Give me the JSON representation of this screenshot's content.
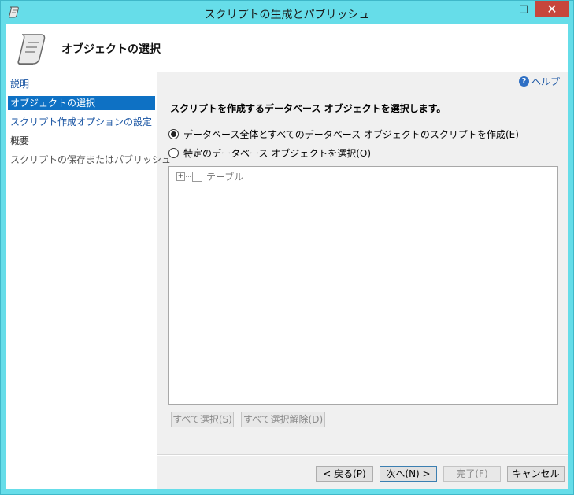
{
  "window": {
    "title": "スクリプトの生成とパブリッシュ",
    "min_glyph": "—",
    "max_glyph": "□",
    "close_glyph": "✕"
  },
  "header": {
    "title": "オブジェクトの選択"
  },
  "nav": {
    "items": [
      {
        "label": "説明"
      },
      {
        "label": "オブジェクトの選択"
      },
      {
        "label": "スクリプト作成オプションの設定"
      },
      {
        "label": "概要"
      },
      {
        "label": "スクリプトの保存またはパブリッシュ"
      }
    ]
  },
  "main": {
    "help_label": "ヘルプ",
    "help_icon_glyph": "?",
    "instruction": "スクリプトを作成するデータベース オブジェクトを選択します。",
    "option_all": "データベース全体とすべてのデータベース オブジェクトのスクリプトを作成(E)",
    "option_specific": "特定のデータベース オブジェクトを選択(O)",
    "tree_node": "テーブル",
    "tree_expander": "+",
    "select_all": "すべて選択(S)",
    "deselect_all": "すべて選択解除(D)"
  },
  "footer": {
    "back": "< 戻る(P)",
    "next": "次へ(N) >",
    "finish": "完了(F)",
    "cancel": "キャンセル"
  },
  "colors": {
    "accent": "#0e71c4",
    "close": "#c7463c",
    "link": "#1a55a3",
    "frame": "#66dde9"
  },
  "icons": [
    "scroll-icon",
    "help-icon",
    "minimize-icon",
    "maximize-icon",
    "close-icon"
  ]
}
